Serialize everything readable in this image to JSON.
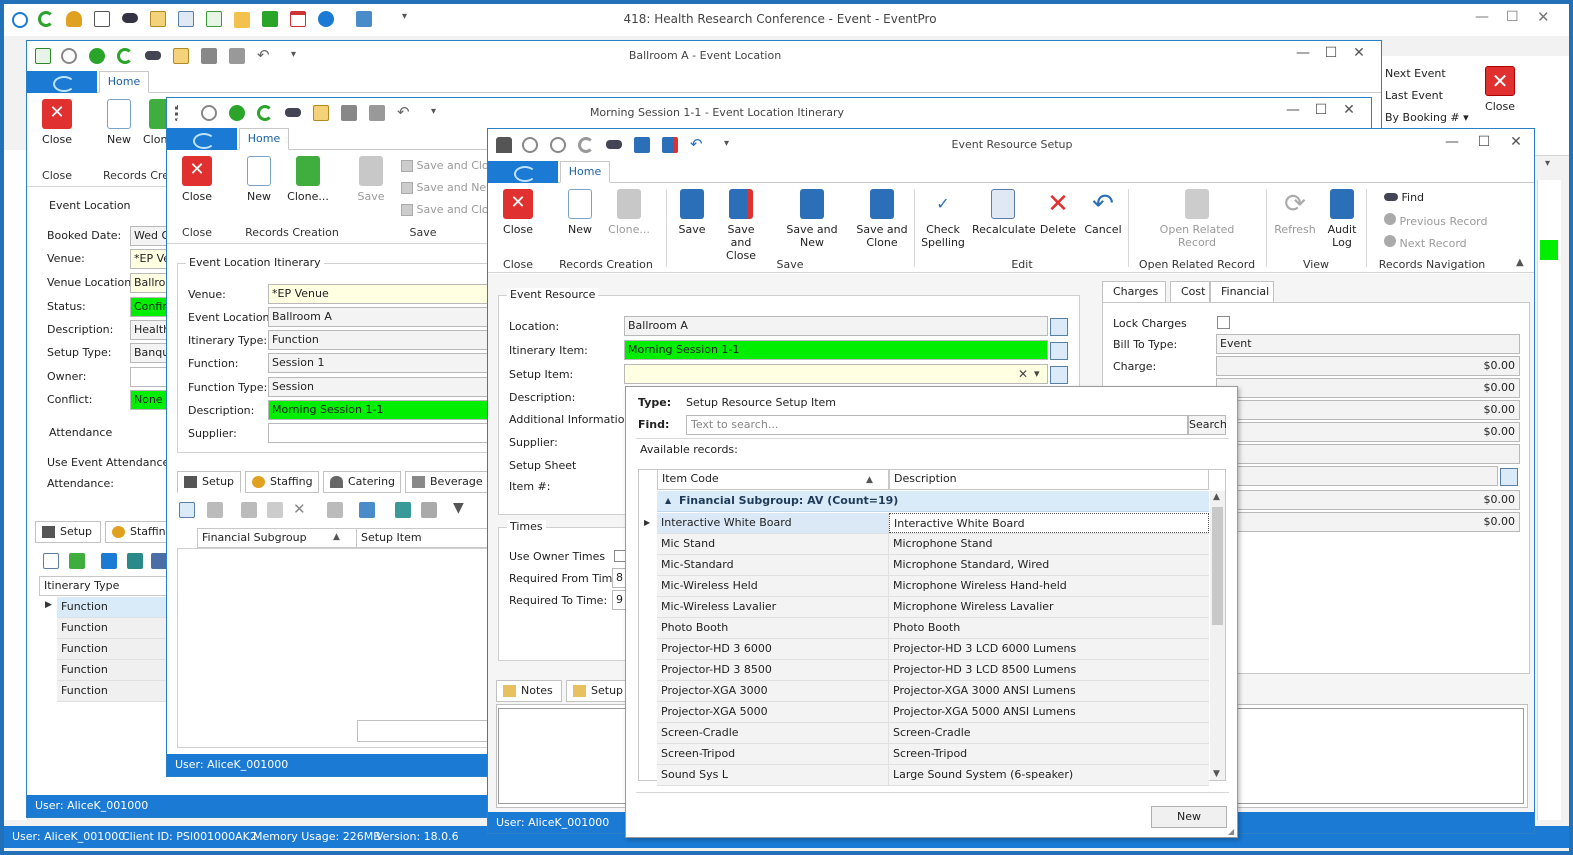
{
  "main_window": {
    "title": "418: Health Research Conference - Event - EventPro",
    "side_items": [
      "Next Event",
      "Last Event",
      "By Booking #"
    ],
    "close_label": "Close",
    "status": {
      "user": "User: AliceK_001000",
      "client": "Client ID: PSI001000AK2",
      "memory": "Memory Usage: 226MB",
      "version": "Version: 18.0.6"
    }
  },
  "ballroom_window": {
    "title": "Ballroom A - Event Location",
    "home_tab": "Home",
    "ribbon": {
      "close": "Close",
      "new": "New",
      "clone": "Clon",
      "group_close": "Close",
      "group_records": "Records Crea"
    },
    "section_title": "Event Location",
    "fields": [
      {
        "label": "Booked Date:",
        "value": "Wed O"
      },
      {
        "label": "Venue:",
        "value": "*EP Ve"
      },
      {
        "label": "Venue Location:",
        "value": "Ballroo"
      },
      {
        "label": "Status:",
        "value": "Confirm"
      },
      {
        "label": "Description:",
        "value": "Health"
      },
      {
        "label": "Setup Type:",
        "value": "Banque"
      },
      {
        "label": "Owner:",
        "value": ""
      },
      {
        "label": "Conflict:",
        "value": "None"
      }
    ],
    "attendance_title": "Attendance",
    "use_event_attendance": "Use Event Attendance",
    "attendance_label": "Attendance:",
    "tabs": [
      "Setup",
      "Staffing"
    ],
    "grid_header": "Itinerary Type",
    "grid_rows": [
      "Function",
      "Function",
      "Function",
      "Function",
      "Function"
    ],
    "status_user": "User: AliceK_001000"
  },
  "itinerary_window": {
    "title": "Morning Session 1-1 - Event Location Itinerary",
    "home_tab": "Home",
    "ribbon": {
      "close": "Close",
      "new": "New",
      "clone": "Clone...",
      "save": "Save",
      "save_close": "Save and Clos",
      "save_new": "Save and New",
      "save_clone": "Save and Clon",
      "group_close": "Close",
      "group_records": "Records Creation",
      "group_save": "Save"
    },
    "section_title": "Event Location Itinerary",
    "fields": [
      {
        "label": "Venue:",
        "value": "*EP Venue"
      },
      {
        "label": "Event Location:",
        "value": "Ballroom A"
      },
      {
        "label": "Itinerary Type:",
        "value": "Function"
      },
      {
        "label": "Function:",
        "value": "Session 1"
      },
      {
        "label": "Function Type:",
        "value": "Session"
      },
      {
        "label": "Description:",
        "value": "Morning Session 1-1"
      },
      {
        "label": "Supplier:",
        "value": ""
      }
    ],
    "tabs": [
      "Setup",
      "Staffing",
      "Catering",
      "Beverage"
    ],
    "grid_headers": [
      "Financial Subgroup",
      "Setup Item"
    ],
    "status_user": "User: AliceK_001000"
  },
  "resource_window": {
    "title": "Event Resource Setup",
    "home_tab": "Home",
    "ribbon": {
      "close": "Close",
      "new": "New",
      "clone": "Clone...",
      "save": "Save",
      "save_close": "Save and Close",
      "save_new": "Save and New",
      "save_clone": "Save and Clone",
      "check_spelling": "Check Spelling",
      "recalculate": "Recalculate",
      "delete": "Delete",
      "cancel": "Cancel",
      "open_related": "Open Related Record",
      "refresh": "Refresh",
      "audit_log": "Audit Log",
      "find": "Find",
      "previous_record": "Previous Record",
      "next_record": "Next Record",
      "groups": [
        "Close",
        "Records Creation",
        "Save",
        "Edit",
        "Open Related Record",
        "View",
        "Records Navigation"
      ]
    },
    "section_title": "Event Resource",
    "fields": [
      {
        "label": "Location:",
        "value": "Ballroom A"
      },
      {
        "label": "Itinerary Item:",
        "value": "Morning Session 1-1"
      },
      {
        "label": "Setup Item:",
        "value": ""
      },
      {
        "label": "Description:",
        "value": ""
      },
      {
        "label": "Additional Information:",
        "value": ""
      },
      {
        "label": "Supplier:",
        "value": ""
      },
      {
        "label": "Setup Sheet",
        "value": ""
      },
      {
        "label": "Item #:",
        "value": ""
      }
    ],
    "times_title": "Times",
    "use_owner_times": "Use Owner Times",
    "required_from": {
      "label": "Required From Time:",
      "value": "8"
    },
    "required_to": {
      "label": "Required To Time:",
      "value": "9"
    },
    "bottom_tabs": [
      "Notes",
      "Setup"
    ],
    "charges_tabs": [
      "Charges",
      "Cost",
      "Financial"
    ],
    "lock_charges": "Lock Charges",
    "bill_to_label": "Bill To Type:",
    "bill_to_value": "Event",
    "charge_label": "Charge:",
    "amounts": [
      "$0.00",
      "$0.00",
      "$0.00",
      "$0.00",
      "$0.00",
      "$0.00"
    ],
    "status_user": "User: AliceK_001000"
  },
  "dropdown": {
    "type_label": "Type:",
    "type_value": "Setup Resource Setup Item",
    "find_label": "Find:",
    "search_placeholder": "Text to search...",
    "search_button": "Search",
    "available_records": "Available records:",
    "columns": [
      "Item Code",
      "Description"
    ],
    "group_row": "Financial Subgroup: AV (Count=19)",
    "rows": [
      {
        "code": "Interactive White Board",
        "desc": "Interactive White Board"
      },
      {
        "code": "Mic Stand",
        "desc": "Microphone Stand"
      },
      {
        "code": "Mic-Standard",
        "desc": "Microphone Standard, Wired"
      },
      {
        "code": "Mic-Wireless Held",
        "desc": "Microphone Wireless Hand-held"
      },
      {
        "code": "Mic-Wireless Lavalier",
        "desc": "Microphone Wireless Lavalier"
      },
      {
        "code": "Photo Booth",
        "desc": "Photo Booth"
      },
      {
        "code": "Projector-HD 3 6000",
        "desc": "Projector-HD 3 LCD 6000 Lumens"
      },
      {
        "code": "Projector-HD 3 8500",
        "desc": "Projector-HD 3 LCD 8500 Lumens"
      },
      {
        "code": "Projector-XGA 3000",
        "desc": "Projector-XGA 3000 ANSI Lumens"
      },
      {
        "code": "Projector-XGA 5000",
        "desc": "Projector-XGA 5000 ANSI Lumens"
      },
      {
        "code": "Screen-Cradle",
        "desc": "Screen-Cradle"
      },
      {
        "code": "Screen-Tripod",
        "desc": "Screen-Tripod"
      },
      {
        "code": "Sound Sys L",
        "desc": "Large Sound System (6-speaker)"
      }
    ],
    "new_button": "New"
  }
}
